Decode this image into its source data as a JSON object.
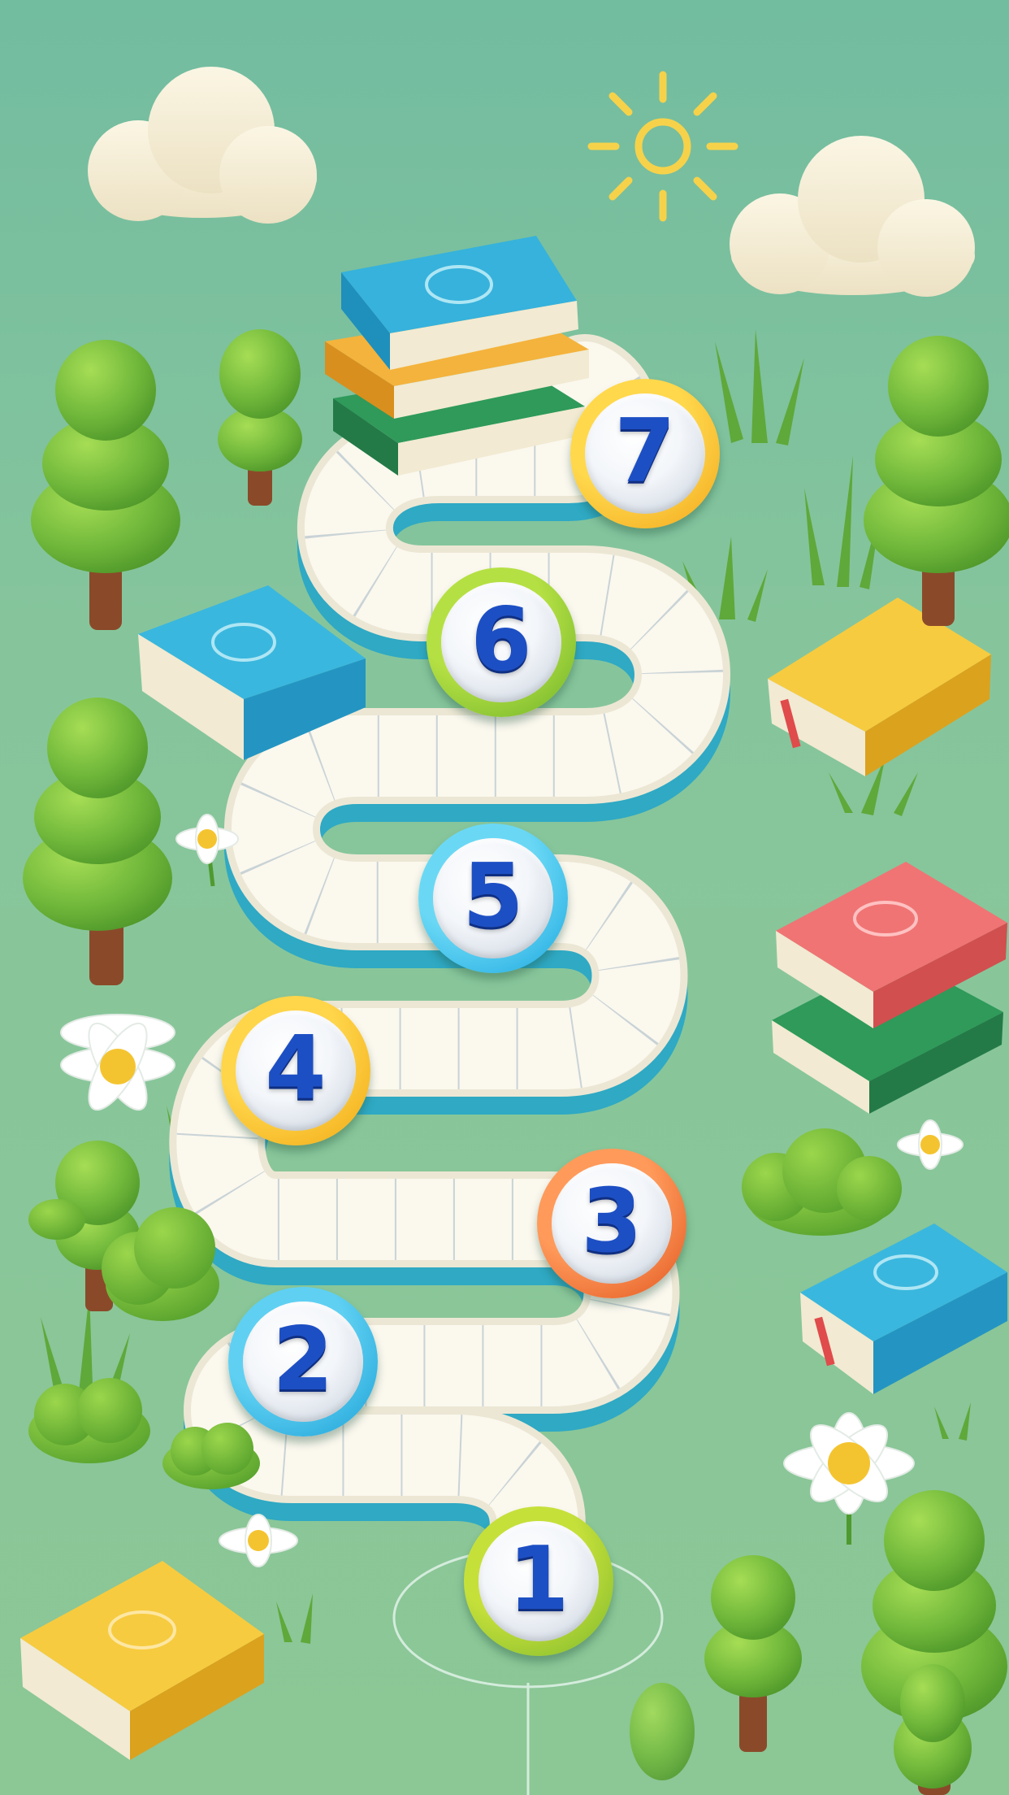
{
  "levels": [
    {
      "number": "1",
      "ring_colors": [
        "#c6e03a",
        "#7cb82c"
      ]
    },
    {
      "number": "2",
      "ring_colors": [
        "#5fd0f2",
        "#1a9fd6"
      ]
    },
    {
      "number": "3",
      "ring_colors": [
        "#ff9a5a",
        "#e0541f"
      ]
    },
    {
      "number": "4",
      "ring_colors": [
        "#ffd54a",
        "#f0a712"
      ]
    },
    {
      "number": "5",
      "ring_colors": [
        "#6ad8f5",
        "#1aa6df"
      ]
    },
    {
      "number": "6",
      "ring_colors": [
        "#b5e043",
        "#6db22a"
      ]
    },
    {
      "number": "7",
      "ring_colors": [
        "#ffd84c",
        "#f2a51a"
      ]
    }
  ],
  "colors": {
    "background": "#7cc0a1",
    "grass": "#8cc49a",
    "path_top": "#fbf8ec",
    "path_side": "#35b6cf",
    "number_text": "#1d4fc4"
  },
  "icons": {
    "sun": "sun-icon",
    "cloud": "cloud-icon",
    "tree": "tree-icon",
    "book": "book-icon",
    "flower": "daisy-icon",
    "bush": "bush-icon"
  }
}
